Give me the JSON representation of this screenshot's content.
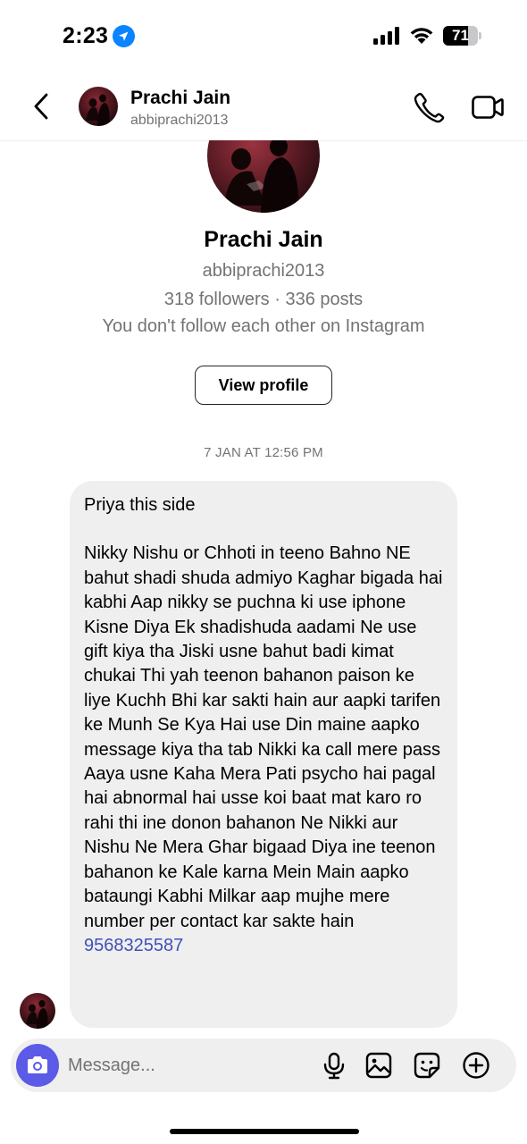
{
  "status_bar": {
    "time": "2:23",
    "battery": "71",
    "battery_level": 0.71,
    "icons": [
      "location-arrow-icon",
      "signal-icon",
      "wifi-icon",
      "battery-icon"
    ]
  },
  "header": {
    "name": "Prachi Jain",
    "username": "abbiprachi2013",
    "icons": [
      "back-chevron-icon",
      "phone-icon",
      "video-camera-icon"
    ]
  },
  "profile": {
    "name": "Prachi Jain",
    "username": "abbiprachi2013",
    "stats": "318 followers · 336 posts",
    "follow_status": "You don't follow each other on Instagram",
    "view_profile_label": "View profile"
  },
  "conversation": {
    "timestamp": "7 JAN AT 12:56 PM",
    "message": {
      "greeting": "Priya this side",
      "paragraph1": "Nikky Nishu or Chhoti in teeno Bahno NE bahut shadi shuda admiyo Kaghar bigada hai",
      "paragraph2": "kabhi Aap nikky se puchna ki use iphone Kisne Diya Ek shadishuda aadami Ne use gift kiya tha Jiski usne bahut badi kimat chukai Thi yah teenon bahanon paison ke liye Kuchh Bhi kar sakti hain aur aapki tarifen ke Munh Se Kya Hai use Din maine aapko message kiya tha tab Nikki ka call mere pass Aaya usne Kaha Mera Pati psycho hai pagal hai abnormal hai usse koi baat mat karo ro rahi thi ine donon bahanon Ne Nikki aur Nishu Ne Mera Ghar bigaad Diya ine teenon bahanon ke Kale karna Mein Main aapko bataungi Kabhi Milkar aap mujhe mere number per contact kar sakte hain",
      "phone_link": "9568325587"
    }
  },
  "composer": {
    "placeholder": "Message...",
    "icons": [
      "camera-icon",
      "microphone-icon",
      "gallery-icon",
      "sticker-icon",
      "plus-circle-icon"
    ]
  },
  "colors": {
    "accent": "#5b5be8",
    "link": "#4150b8",
    "bubble": "#efefef",
    "secondary_text": "#737373",
    "location_blue": "#0a84ff"
  }
}
